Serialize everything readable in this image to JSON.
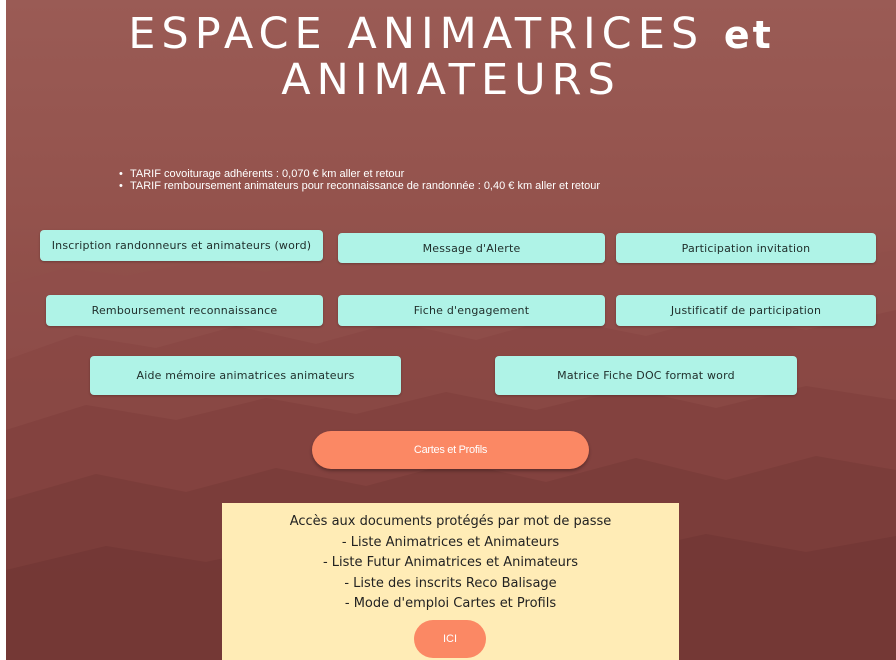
{
  "header": {
    "title_line1": "ESPACE ANIMATRICES",
    "title_line1_suffix": "et",
    "title_line2": "ANIMATEURS"
  },
  "tarifs": [
    "TARIF covoiturage adhérents : 0,070 € km aller et retour",
    "TARIF remboursement animateurs pour reconnaissance de randonnée : 0,40 € km aller et retour"
  ],
  "buttons": {
    "inscription": "Inscription randonneurs et animateurs (word)",
    "message_alerte": "Message d'Alerte",
    "participation_invitation": "Participation invitation",
    "remboursement": "Remboursement reconnaissance",
    "fiche_engagement": "Fiche d'engagement",
    "justificatif": "Justificatif de participation",
    "aide_memoire": "Aide mémoire animatrices animateurs",
    "matrice_fiche": "Matrice Fiche DOC format word",
    "cartes_profils": "Cartes et Profils"
  },
  "access_box": {
    "lines": [
      "Accès aux documents protégés par mot de passe",
      "- Liste Animatrices et Animateurs",
      "- Liste Futur Animatrices et Animateurs",
      "- Liste des inscrits Reco Balisage",
      "- Mode d'emploi Cartes et Profils"
    ],
    "button_label": "ICI"
  },
  "colors": {
    "background": "#8e4e49",
    "button_bg": "#aff3e7",
    "cta": "#fb8864",
    "access_bg": "#ffecb6"
  }
}
